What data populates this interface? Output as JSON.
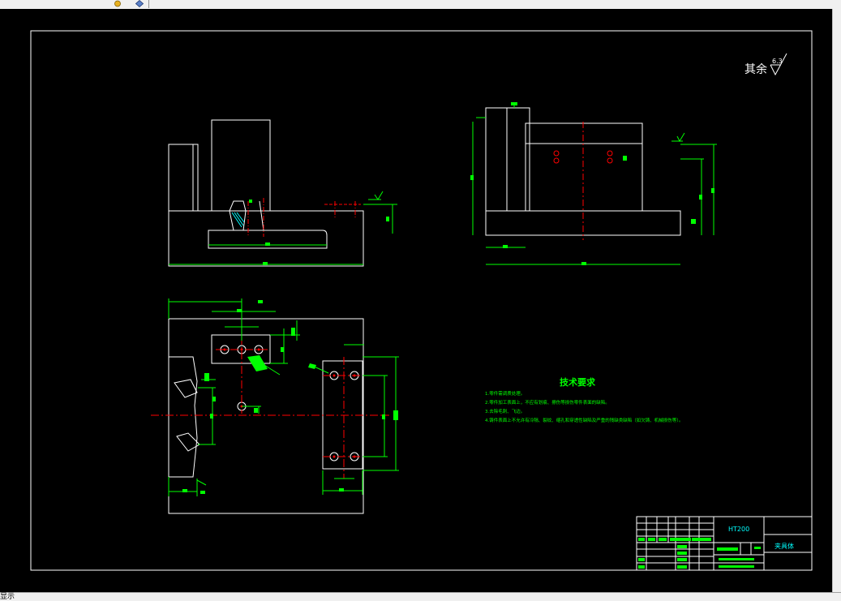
{
  "toolbar": {
    "icons": [
      "layer-icon",
      "properties-icon"
    ]
  },
  "drawing": {
    "surface_note": "其余",
    "surface_roughness": "6.3",
    "tech_title": "技术要求",
    "tech_lines": [
      "1.零件需调质处理。",
      "2.零件加工表面上，不应有划痕、擦伤等损伤零件表面的缺陷。",
      "3.去除毛刺、飞边。",
      "4.铸件表面上不允许有冷隔、裂纹、缩孔和穿透性缺陷及严重的残缺类缺陷（如欠铸、机械损伤等）。"
    ],
    "title_block": {
      "material": "HT200",
      "part_name": "夹具体"
    },
    "colors": {
      "background": "#000000",
      "lines": "#ffffff",
      "dimensions": "#00ff00",
      "centerlines": "#ff0000",
      "title_text": "#00ffff"
    }
  },
  "statusbar": {
    "text": "显示"
  }
}
